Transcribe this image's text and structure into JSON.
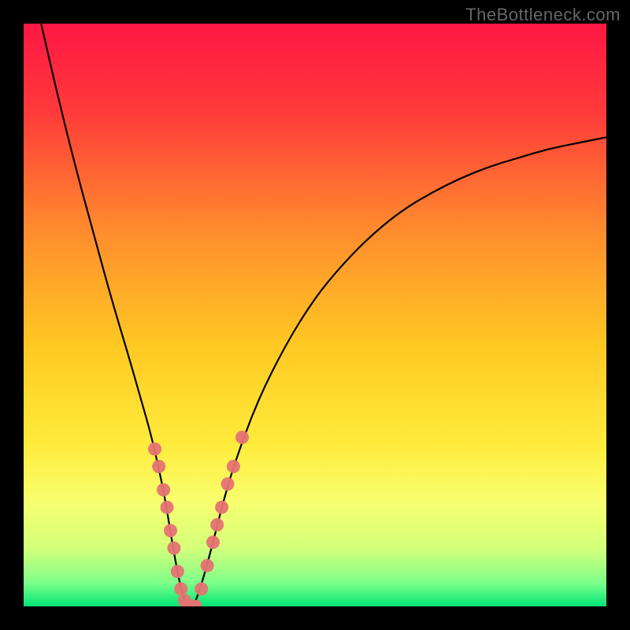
{
  "watermark": "TheBottleneck.com",
  "chart_data": {
    "type": "line",
    "title": "",
    "xlabel": "",
    "ylabel": "",
    "xlim": [
      0,
      100
    ],
    "ylim": [
      0,
      100
    ],
    "background_gradient": {
      "stops": [
        {
          "offset": 0,
          "color": "#ff1744"
        },
        {
          "offset": 15,
          "color": "#ff3a3a"
        },
        {
          "offset": 35,
          "color": "#ff8a2e"
        },
        {
          "offset": 55,
          "color": "#ffc823"
        },
        {
          "offset": 72,
          "color": "#ffeb3b"
        },
        {
          "offset": 82,
          "color": "#f8ff6e"
        },
        {
          "offset": 90,
          "color": "#d4ff7a"
        },
        {
          "offset": 96,
          "color": "#7dff8a"
        },
        {
          "offset": 100,
          "color": "#00e676"
        }
      ]
    },
    "series": [
      {
        "name": "bottleneck-curve",
        "type": "line",
        "x": [
          3,
          6,
          9,
          12,
          15,
          18,
          20,
          22,
          24,
          25,
          26,
          27,
          28,
          29,
          30,
          32,
          34,
          36,
          40,
          45,
          50,
          55,
          60,
          65,
          70,
          75,
          80,
          85,
          90,
          95,
          100
        ],
        "y": [
          100,
          87,
          75,
          64,
          53,
          43,
          36,
          29,
          20,
          14,
          8,
          3,
          0,
          0,
          2,
          9,
          17,
          24,
          35,
          45,
          53,
          59,
          64,
          68,
          71,
          73.5,
          75.5,
          77,
          78.5,
          79.5,
          80.5
        ]
      },
      {
        "name": "data-points",
        "type": "scatter",
        "color": "#e57373",
        "x": [
          22.5,
          23.2,
          24.0,
          24.6,
          25.2,
          25.8,
          26.4,
          27.0,
          27.6,
          28.2,
          28.8,
          29.5,
          30.5,
          31.5,
          32.5,
          33.2,
          34.0,
          35.0,
          36.0,
          37.5
        ],
        "y": [
          27,
          24,
          20,
          17,
          13,
          10,
          6,
          3,
          1,
          0,
          0,
          0,
          3,
          7,
          11,
          14,
          17,
          21,
          24,
          29
        ]
      }
    ]
  }
}
